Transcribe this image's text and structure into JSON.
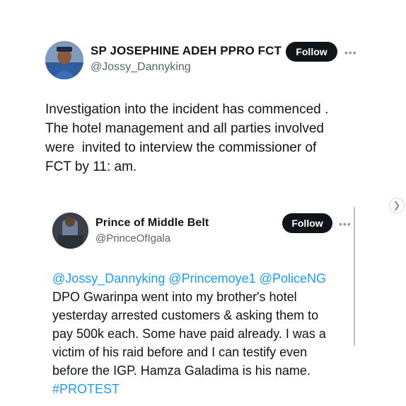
{
  "main_tweet": {
    "author_name": "SP JOSEPHINE ADEH PPRO FCT",
    "handle": "@Jossy_Dannyking",
    "follow_label": "Follow",
    "more_icon": "more-horizontal-icon",
    "text_lines": [
      "Investigation into the incident has commenced .",
      "The hotel management and all parties involved",
      "were  invited to interview the commissioner of",
      "FCT by 11: am."
    ]
  },
  "quoted_tweet": {
    "author_name": "Prince of Middle Belt",
    "handle": "@PrinceOfIgala",
    "follow_label": "Follow",
    "more_icon": "more-horizontal-icon",
    "mentions": "@Jossy_Dannyking @Princemoye1 @PoliceNG",
    "text_lines": [
      "DPO Gwarinpa went into my brother's hotel",
      "yesterday arrested customers & asking them to",
      "pay 500k each. Some have paid already. I was a",
      "victim of his raid before and I can testify even",
      "before the IGP. Hamza Galadima is his name."
    ],
    "hashtag": "#PROTEST"
  },
  "carousel": {
    "next_icon": "chevron-right-icon"
  },
  "colors": {
    "text": "#0f1419",
    "secondary": "#536471",
    "link": "#1d9bf0",
    "follow_bg": "#0f1419"
  }
}
